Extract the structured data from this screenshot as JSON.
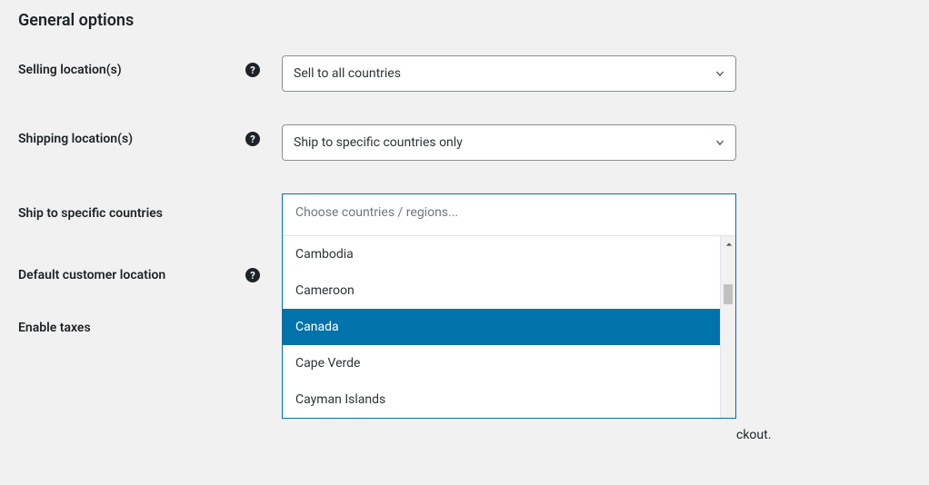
{
  "page_title": "General options",
  "rows": {
    "selling_locations": {
      "label": "Selling location(s)",
      "value": "Sell to all countries"
    },
    "shipping_locations": {
      "label": "Shipping location(s)",
      "value": "Ship to specific countries only"
    },
    "ship_to_countries": {
      "label": "Ship to specific countries",
      "placeholder": "Choose countries / regions...",
      "options_visible": [
        "Cambodia",
        "Cameroon",
        "Canada",
        "Cape Verde",
        "Cayman Islands"
      ],
      "highlighted": "Canada"
    },
    "default_customer_location": {
      "label": "Default customer location"
    },
    "enable_taxes": {
      "label": "Enable taxes"
    }
  },
  "trailing_text": "ckout."
}
